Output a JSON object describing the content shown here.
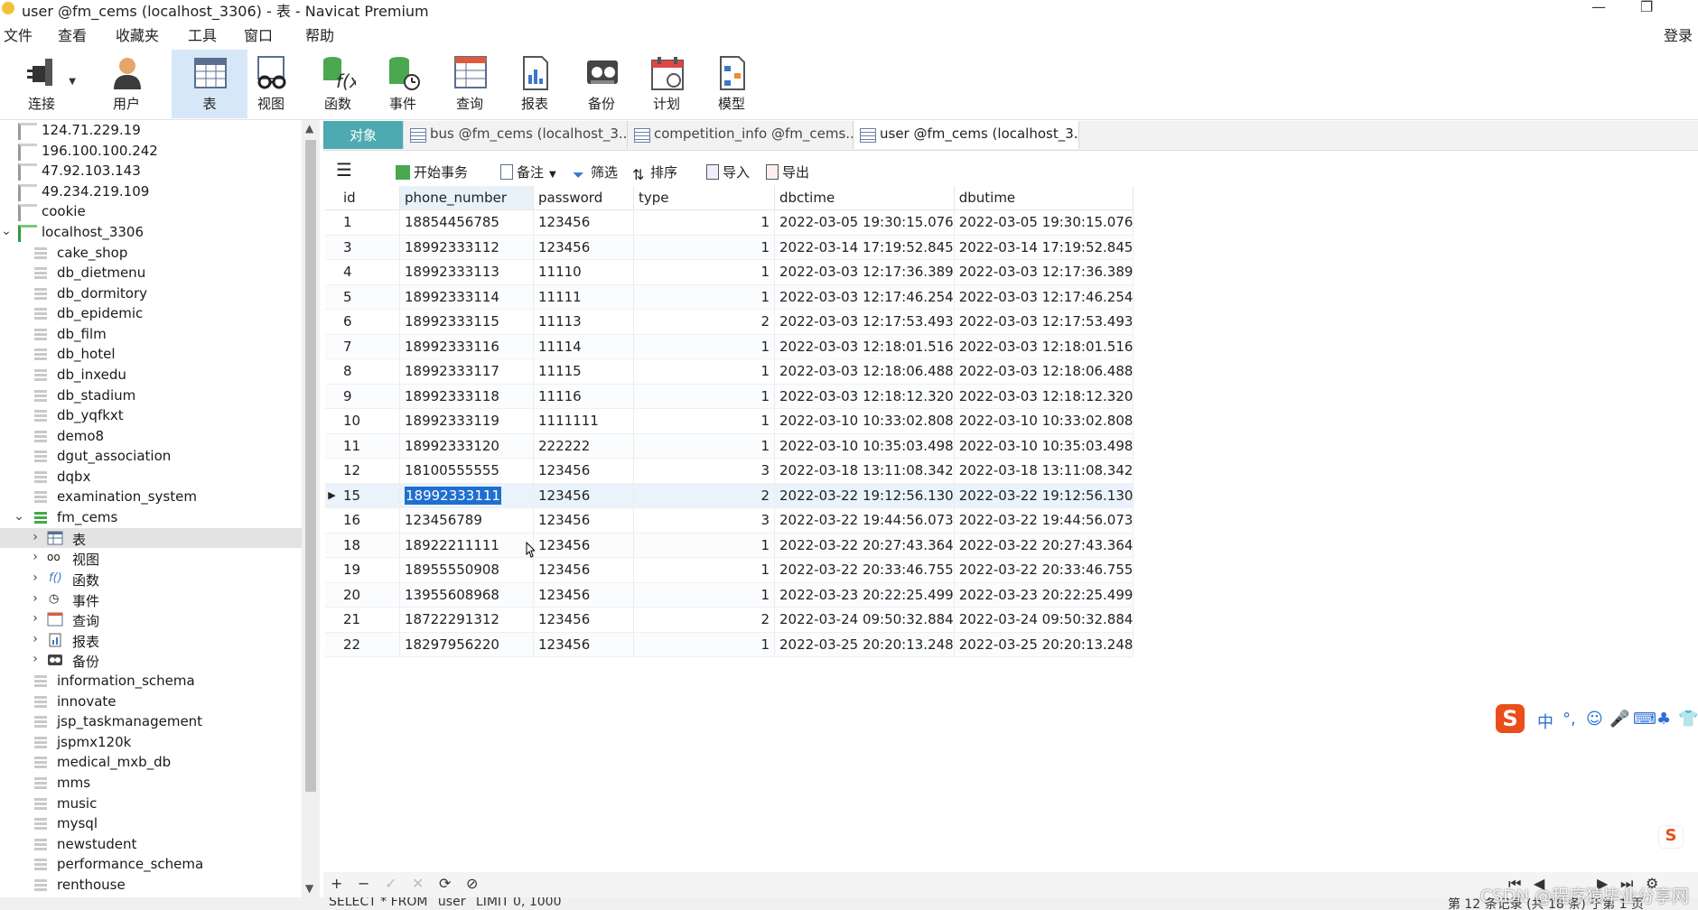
{
  "window": {
    "title": "user @fm_cems (localhost_3306) - 表 - Navicat Premium",
    "controls": [
      "—",
      "❐"
    ]
  },
  "menu": [
    "文件",
    "查看",
    "收藏夹",
    "工具",
    "窗口",
    "帮助"
  ],
  "menu_login": "登录",
  "toolbar": [
    {
      "label": "连接",
      "icon": "plug-icon"
    },
    {
      "label": "用户",
      "icon": "user-icon"
    },
    {
      "label": "表",
      "icon": "table-icon"
    },
    {
      "label": "视图",
      "icon": "view-glasses-icon"
    },
    {
      "label": "函数",
      "icon": "function-icon"
    },
    {
      "label": "事件",
      "icon": "event-clock-icon"
    },
    {
      "label": "查询",
      "icon": "query-icon"
    },
    {
      "label": "报表",
      "icon": "report-icon"
    },
    {
      "label": "备份",
      "icon": "backup-icon"
    },
    {
      "label": "计划",
      "icon": "schedule-icon"
    },
    {
      "label": "模型",
      "icon": "model-icon"
    }
  ],
  "tree": [
    {
      "label": "124.71.229.19"
    },
    {
      "label": "196.100.100.242"
    },
    {
      "label": "47.92.103.143"
    },
    {
      "label": "49.234.219.109"
    },
    {
      "label": "cookie"
    },
    {
      "label": "localhost_3306"
    },
    {
      "label": "cake_shop"
    },
    {
      "label": "db_dietmenu"
    },
    {
      "label": "db_dormitory"
    },
    {
      "label": "db_epidemic"
    },
    {
      "label": "db_film"
    },
    {
      "label": "db_hotel"
    },
    {
      "label": "db_inxedu"
    },
    {
      "label": "db_stadium"
    },
    {
      "label": "db_yqfkxt"
    },
    {
      "label": "demo8"
    },
    {
      "label": "dgut_association"
    },
    {
      "label": "dqbx"
    },
    {
      "label": "examination_system"
    },
    {
      "label": "fm_cems"
    },
    {
      "label": "表"
    },
    {
      "label": "视图"
    },
    {
      "label": "函数"
    },
    {
      "label": "事件"
    },
    {
      "label": "查询"
    },
    {
      "label": "报表"
    },
    {
      "label": "备份"
    },
    {
      "label": "information_schema"
    },
    {
      "label": "innovate"
    },
    {
      "label": "jsp_taskmanagement"
    },
    {
      "label": "jspmx120k"
    },
    {
      "label": "medical_mxb_db"
    },
    {
      "label": "mms"
    },
    {
      "label": "music"
    },
    {
      "label": "mysql"
    },
    {
      "label": "newstudent"
    },
    {
      "label": "performance_schema"
    },
    {
      "label": "renthouse"
    }
  ],
  "tabs": [
    {
      "label": "对象"
    },
    {
      "label": "bus @fm_cems (localhost_3..."
    },
    {
      "label": "competition_info @fm_cems..."
    },
    {
      "label": "user @fm_cems (localhost_3..."
    }
  ],
  "subtoolbar": {
    "menu_icon": "hamburger-icon",
    "begin_tx": "开始事务",
    "note": "备注",
    "filter": "筛选",
    "sort": "排序",
    "import": "导入",
    "export": "导出"
  },
  "grid": {
    "columns": [
      "id",
      "phone_number",
      "password",
      "type",
      "dbctime",
      "dbutime"
    ],
    "rows": [
      [
        "1",
        "18854456785",
        "123456",
        "1",
        "2022-03-05 19:30:15.076",
        "2022-03-05 19:30:15.076"
      ],
      [
        "3",
        "18992333112",
        "123456",
        "1",
        "2022-03-14 17:19:52.845",
        "2022-03-14 17:19:52.845"
      ],
      [
        "4",
        "18992333113",
        "11110",
        "1",
        "2022-03-03 12:17:36.389",
        "2022-03-03 12:17:36.389"
      ],
      [
        "5",
        "18992333114",
        "11111",
        "1",
        "2022-03-03 12:17:46.254",
        "2022-03-03 12:17:46.254"
      ],
      [
        "6",
        "18992333115",
        "11113",
        "2",
        "2022-03-03 12:17:53.493",
        "2022-03-03 12:17:53.493"
      ],
      [
        "7",
        "18992333116",
        "11114",
        "1",
        "2022-03-03 12:18:01.516",
        "2022-03-03 12:18:01.516"
      ],
      [
        "8",
        "18992333117",
        "11115",
        "1",
        "2022-03-03 12:18:06.488",
        "2022-03-03 12:18:06.488"
      ],
      [
        "9",
        "18992333118",
        "11116",
        "1",
        "2022-03-03 12:18:12.320",
        "2022-03-03 12:18:12.320"
      ],
      [
        "10",
        "18992333119",
        "1111111",
        "1",
        "2022-03-10 10:33:02.808",
        "2022-03-10 10:33:02.808"
      ],
      [
        "11",
        "18992333120",
        "222222",
        "1",
        "2022-03-10 10:35:03.498",
        "2022-03-10 10:35:03.498"
      ],
      [
        "12",
        "18100555555",
        "123456",
        "3",
        "2022-03-18 13:11:08.342",
        "2022-03-18 13:11:08.342"
      ],
      [
        "15",
        "18992333111",
        "123456",
        "2",
        "2022-03-22 19:12:56.130",
        "2022-03-22 19:12:56.130"
      ],
      [
        "16",
        "123456789",
        "123456",
        "3",
        "2022-03-22 19:44:56.073",
        "2022-03-22 19:44:56.073"
      ],
      [
        "18",
        "18922211111",
        "123456",
        "1",
        "2022-03-22 20:27:43.364",
        "2022-03-22 20:27:43.364"
      ],
      [
        "19",
        "18955550908",
        "123456",
        "1",
        "2022-03-22 20:33:46.755",
        "2022-03-22 20:33:46.755"
      ],
      [
        "20",
        "13955608968",
        "123456",
        "1",
        "2022-03-23 20:22:25.499",
        "2022-03-23 20:22:25.499"
      ],
      [
        "21",
        "18722291312",
        "123456",
        "2",
        "2022-03-24 09:50:32.884",
        "2022-03-24 09:50:32.884"
      ],
      [
        "22",
        "18297956220",
        "123456",
        "1",
        "2022-03-25 20:20:13.248",
        "2022-03-25 20:20:13.248"
      ]
    ],
    "current_row_index": 11,
    "selected_cell": "18992333111"
  },
  "bottom_nav": {
    "add": "+",
    "delete": "−",
    "apply": "✓",
    "discard": "✕",
    "refresh": "⟳",
    "stop": "⊘"
  },
  "statusbar": {
    "sql": "SELECT * FROM `user` LIMIT 0, 1000",
    "records": "第 12 条记录 (共 18 条) 于第 1 页"
  },
  "ime": {
    "logo": "S",
    "items": [
      "中",
      "°,",
      "☺",
      "🎤",
      "⌨",
      "♣",
      "👕"
    ]
  },
  "watermark": "CSDN @程序猿毕业分享网"
}
